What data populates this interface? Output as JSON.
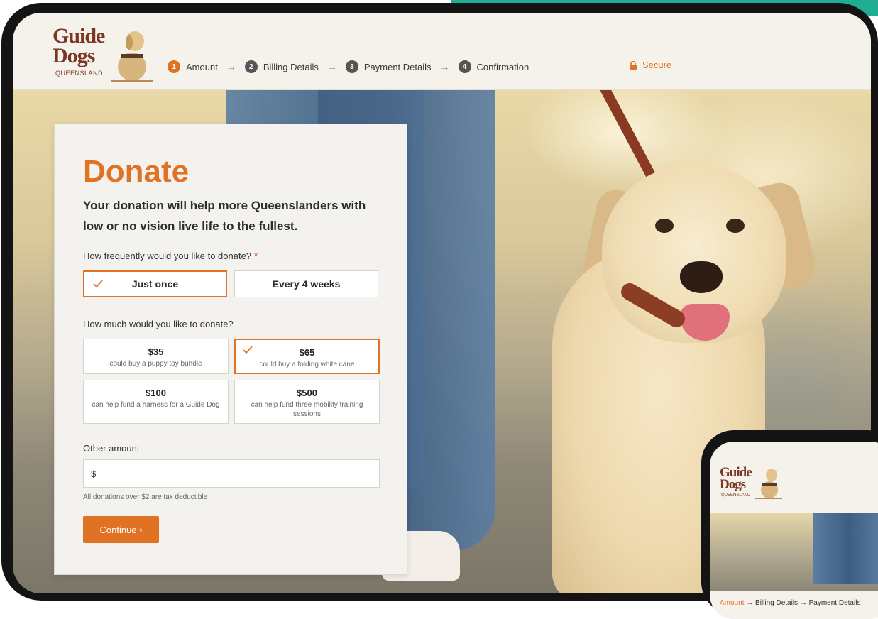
{
  "header": {
    "logo": {
      "line1": "Guide",
      "line2": "Dogs",
      "sub": "QUEENSLAND"
    },
    "steps": [
      {
        "num": "1",
        "label": "Amount",
        "active": true
      },
      {
        "num": "2",
        "label": "Billing Details",
        "active": false
      },
      {
        "num": "3",
        "label": "Payment Details",
        "active": false
      },
      {
        "num": "4",
        "label": "Confirmation",
        "active": false
      }
    ],
    "secure_label": "Secure",
    "secure_icon": "lock-icon"
  },
  "form": {
    "title": "Donate",
    "subtitle": "Your donation will help more Queenslanders with low or no vision live life to the fullest.",
    "frequency": {
      "label": "How frequently would you like to donate?",
      "required_mark": "*",
      "options": [
        {
          "label": "Just once",
          "selected": true
        },
        {
          "label": "Every 4 weeks",
          "selected": false
        }
      ]
    },
    "amount": {
      "label": "How much would you like to donate?",
      "options": [
        {
          "value": "$35",
          "desc": "could buy a puppy toy bundle",
          "selected": false
        },
        {
          "value": "$65",
          "desc": "could buy a folding white cane",
          "selected": true
        },
        {
          "value": "$100",
          "desc": "can help fund a harness for a Guide Dog",
          "selected": false
        },
        {
          "value": "$500",
          "desc": "can help fund three mobility training sessions",
          "selected": false
        }
      ]
    },
    "other": {
      "label": "Other amount",
      "prefix": "$",
      "value": ""
    },
    "tax_note": "All donations over $2 are tax deductible",
    "continue_label": "Continue ›"
  },
  "phone": {
    "logo": {
      "line1": "Guide",
      "line2": "Dogs",
      "sub": "QUEENSLAND"
    },
    "steps": {
      "active": "Amount",
      "rest": " → Billing Details → Payment Details"
    }
  },
  "colors": {
    "accent": "#e07224",
    "brand": "#7a3621",
    "teal": "#1fae94",
    "frame": "#141414"
  }
}
